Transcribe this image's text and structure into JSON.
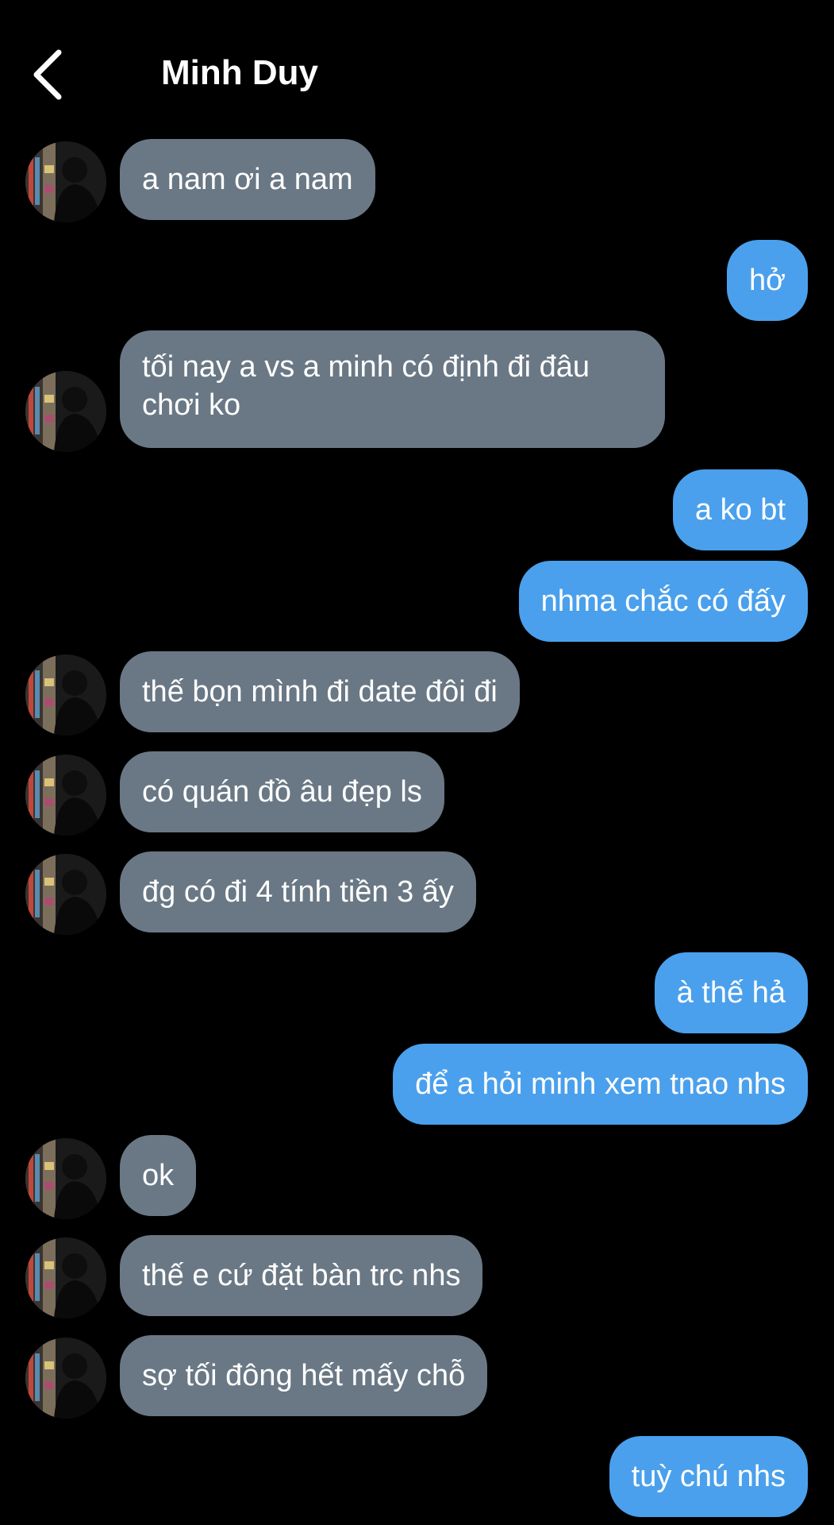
{
  "header": {
    "title": "Minh Duy",
    "back_icon": "chevron-left-icon"
  },
  "colors": {
    "background": "#000000",
    "incoming_bubble": "#6a7885",
    "outgoing_bubble": "#4aa0ec",
    "text": "#ffffff"
  },
  "messages": [
    {
      "side": "in",
      "text": "a nam ơi a nam"
    },
    {
      "side": "out",
      "text": "hở"
    },
    {
      "side": "in",
      "text": "tối nay a vs a minh có định đi đâu chơi ko"
    },
    {
      "side": "out",
      "text": "a ko bt"
    },
    {
      "side": "out",
      "text": "nhma chắc có đấy"
    },
    {
      "side": "in",
      "text": "thế bọn mình đi date đôi đi"
    },
    {
      "side": "in",
      "text": "có quán đồ âu đẹp ls"
    },
    {
      "side": "in",
      "text": "đg có đi 4 tính tiền 3 ấy"
    },
    {
      "side": "out",
      "text": "à thế hả"
    },
    {
      "side": "out",
      "text": "để a hỏi minh xem tnao nhs"
    },
    {
      "side": "in",
      "text": "ok"
    },
    {
      "side": "in",
      "text": "thế e cứ đặt bàn trc nhs"
    },
    {
      "side": "in",
      "text": "sợ tối đông hết mấy chỗ"
    },
    {
      "side": "out",
      "text": "tuỳ chú nhs"
    }
  ]
}
